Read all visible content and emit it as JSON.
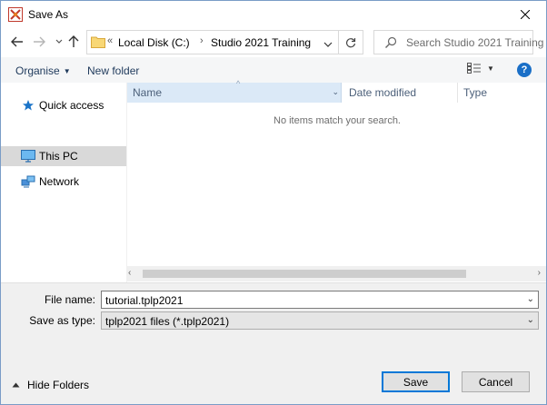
{
  "window": {
    "title": "Save As",
    "accent": "#0078d7"
  },
  "titlebar": {
    "app_icon": "app-logo-icon",
    "close_icon": "close-icon"
  },
  "nav": {
    "back_icon": "arrow-left-icon",
    "forward_icon": "arrow-right-icon",
    "recent_icon": "chevron-down-icon",
    "up_icon": "arrow-up-icon",
    "address": {
      "overflow": "«",
      "segments": [
        "Local Disk (C:)",
        "Studio 2021 Training"
      ],
      "separator": "›"
    },
    "refresh_icon": "refresh-icon",
    "search_placeholder": "Search Studio 2021 Training"
  },
  "toolbar": {
    "organise": "Organise",
    "new_folder": "New folder",
    "view_icon": "view-options-icon",
    "help": "?"
  },
  "sidebar": {
    "items": [
      {
        "label": "Quick access",
        "icon": "star-icon",
        "selected": false
      },
      {
        "label": "This PC",
        "icon": "computer-icon",
        "selected": true
      },
      {
        "label": "Network",
        "icon": "network-icon",
        "selected": false
      }
    ]
  },
  "filelist": {
    "columns": [
      "Name",
      "Date modified",
      "Type"
    ],
    "empty_message": "No items match your search."
  },
  "form": {
    "file_name_label": "File name:",
    "file_name_value": "tutorial.tplp2021",
    "save_type_label": "Save as type:",
    "save_type_value": "tplp2021 files (*.tplp2021)"
  },
  "footer": {
    "hide_folders": "Hide Folders",
    "save": "Save",
    "cancel": "Cancel"
  }
}
